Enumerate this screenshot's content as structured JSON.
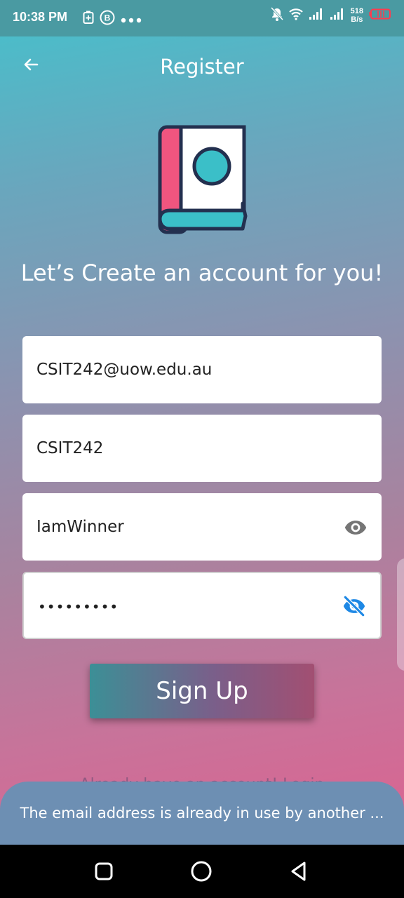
{
  "status_bar": {
    "time": "10:38 PM",
    "left_icons": [
      "battery-saver-icon",
      "b-circle-icon",
      "more-dots-icon"
    ],
    "right_icons": [
      "mute-bell-icon",
      "wifi-icon",
      "signal-icon",
      "signal-icon",
      "battery-icon"
    ],
    "speed_value": "518",
    "speed_unit": "B/s"
  },
  "app_bar": {
    "back_icon": "arrow-left-icon",
    "title": "Register"
  },
  "logo": {
    "icon": "book-logo-icon",
    "colors": {
      "spine": "#f0557f",
      "cover": "#ffffff",
      "circle": "#3bbfc8",
      "outline": "#23304f"
    }
  },
  "headline": "Let’s Create an account for you!",
  "form": {
    "email_value": "CSIT242@uow.edu.au",
    "username_value": "CSIT242",
    "password_value": "IamWinner",
    "password_eye_icon": "eye-icon",
    "confirm_value": "•••••••••",
    "confirm_eye_icon": "eye-off-icon"
  },
  "signup_label": "Sign Up",
  "login_prompt": "Already have an account! Login",
  "toast_message": "The email address is already in use by another ...",
  "nav": {
    "icons": [
      "recent-apps-icon",
      "home-icon",
      "back-triangle-icon"
    ]
  },
  "colors": {
    "accent_blue": "#1e88e5",
    "eye_gray": "#757575"
  }
}
